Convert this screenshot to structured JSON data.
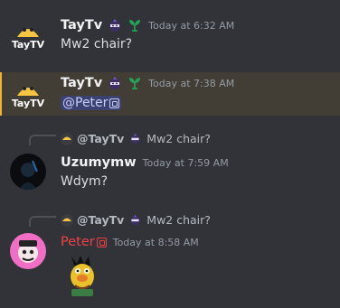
{
  "messages": [
    {
      "author": "TayTv",
      "timestamp": "Today at 6:32 AM",
      "text": "Mw2 chair?",
      "badges": [
        "ninja-badge-icon",
        "sprout-badge-icon"
      ]
    },
    {
      "author": "TayTv",
      "timestamp": "Today at 7:38 AM",
      "mention": "@Peter",
      "highlighted": true,
      "badges": [
        "ninja-badge-icon",
        "sprout-badge-icon"
      ]
    },
    {
      "reply_to": {
        "author": "@TayTv",
        "text": "Mw2 chair?"
      },
      "author": "Uzumymw",
      "timestamp": "Today at 7:59 AM",
      "text": "Wdym?"
    },
    {
      "reply_to": {
        "author": "@TayTv",
        "text": "Mw2 chair?"
      },
      "author": "Peter",
      "timestamp": "Today at 8:58 AM",
      "sticker": "bert-sticker",
      "author_color": "#ed4245"
    }
  ],
  "colors": {
    "background": "#313338",
    "highlight": "#433e35",
    "highlight_bar": "#f0b232",
    "mention_bg": "#3c4270",
    "muted": "#949ba4",
    "username": "#f2f3f5",
    "red_name": "#ed4245"
  }
}
